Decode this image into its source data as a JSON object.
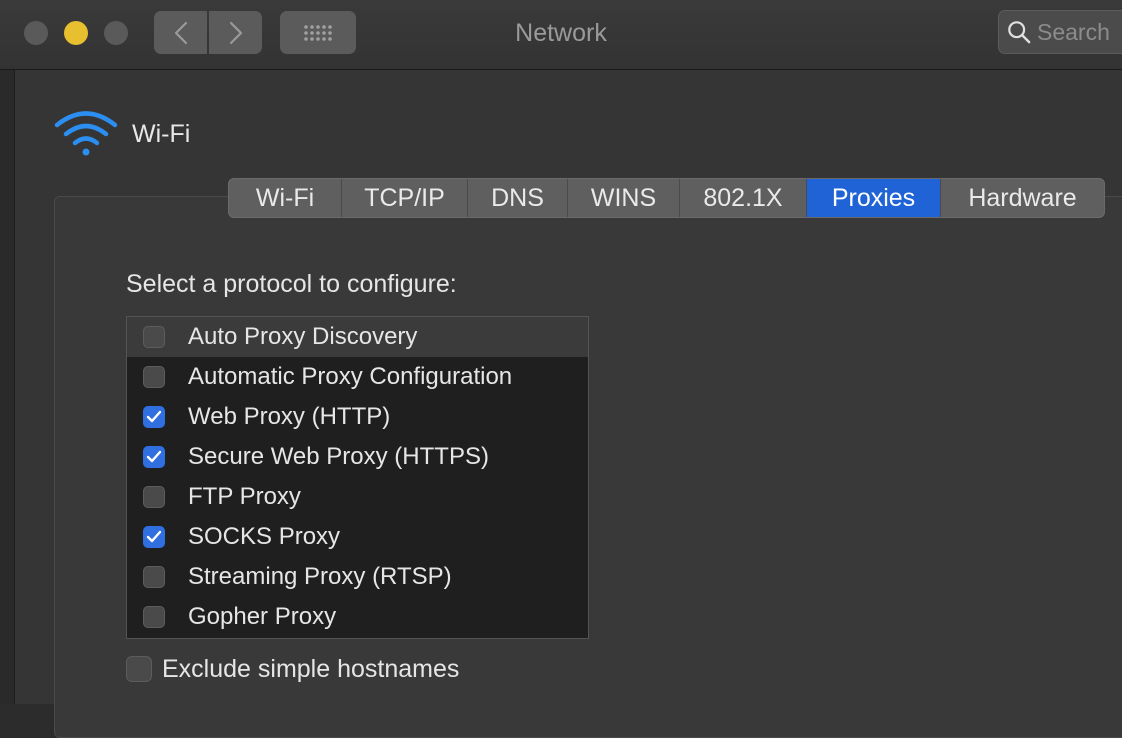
{
  "window": {
    "title": "Network",
    "search_placeholder": "Search"
  },
  "toolbar": {
    "back_icon": "chevron-left-icon",
    "forward_icon": "chevron-right-icon",
    "grid_icon": "grid-icon"
  },
  "interface": {
    "name": "Wi-Fi",
    "icon": "wifi-icon"
  },
  "tabs": [
    {
      "label": "Wi-Fi",
      "active": false
    },
    {
      "label": "TCP/IP",
      "active": false
    },
    {
      "label": "DNS",
      "active": false
    },
    {
      "label": "WINS",
      "active": false
    },
    {
      "label": "802.1X",
      "active": false
    },
    {
      "label": "Proxies",
      "active": true
    },
    {
      "label": "Hardware",
      "active": false
    }
  ],
  "proxies": {
    "section_label": "Select a protocol to configure:",
    "protocols": [
      {
        "label": "Auto Proxy Discovery",
        "checked": false,
        "selected": true
      },
      {
        "label": "Automatic Proxy Configuration",
        "checked": false,
        "selected": false
      },
      {
        "label": "Web Proxy (HTTP)",
        "checked": true,
        "selected": false
      },
      {
        "label": "Secure Web Proxy (HTTPS)",
        "checked": true,
        "selected": false
      },
      {
        "label": "FTP Proxy",
        "checked": false,
        "selected": false
      },
      {
        "label": "SOCKS Proxy",
        "checked": true,
        "selected": false
      },
      {
        "label": "Streaming Proxy (RTSP)",
        "checked": false,
        "selected": false
      },
      {
        "label": "Gopher Proxy",
        "checked": false,
        "selected": false
      }
    ],
    "exclude_simple_hostnames": {
      "label": "Exclude simple hostnames",
      "checked": false
    }
  },
  "colors": {
    "accent": "#1f63d6",
    "wifi_icon": "#2b8ef0",
    "minimize_light": "#e7bf2f"
  }
}
